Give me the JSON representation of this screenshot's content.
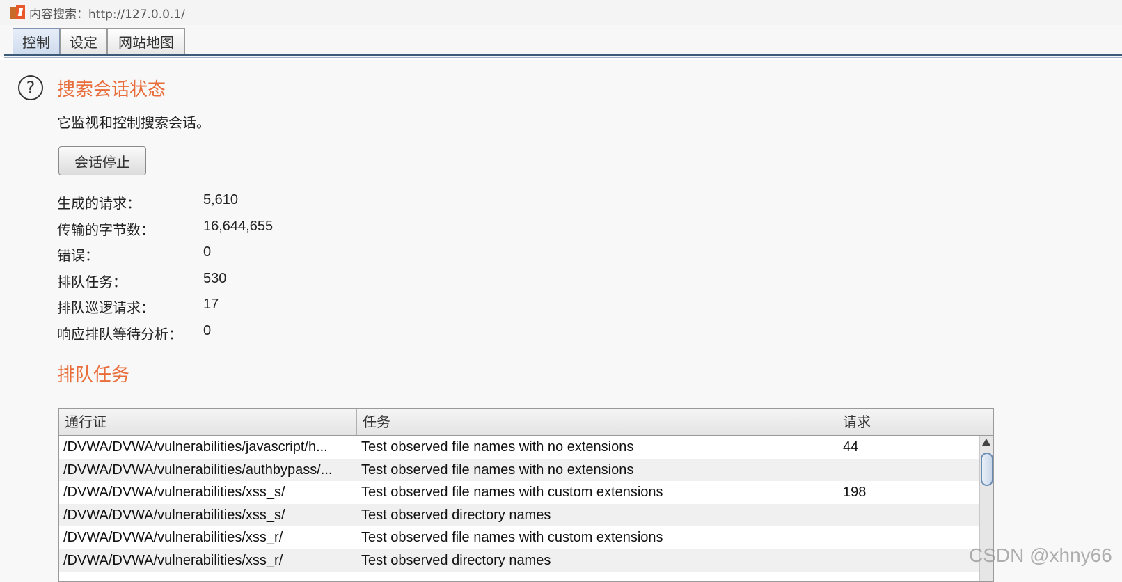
{
  "window": {
    "title": "内容搜索：http://127.0.0.1/"
  },
  "tabs": [
    {
      "label": "控制",
      "active": true
    },
    {
      "label": "设定",
      "active": false
    },
    {
      "label": "网站地图",
      "active": false
    }
  ],
  "session": {
    "title": "搜索会话状态",
    "description": "它监视和控制搜索会话。",
    "stop_button": "会话停止",
    "stats": [
      {
        "label": "生成的请求：",
        "value": "5,610"
      },
      {
        "label": "传输的字节数：",
        "value": "16,644,655"
      },
      {
        "label": "错误：",
        "value": "0"
      },
      {
        "label": "排队任务：",
        "value": "530"
      },
      {
        "label": "排队巡逻请求：",
        "value": "17"
      },
      {
        "label": "响应排队等待分析：",
        "value": "0"
      }
    ]
  },
  "queue": {
    "title": "排队任务",
    "columns": [
      "通行证",
      "任务",
      "请求"
    ],
    "rows": [
      [
        "/DVWA/DVWA/vulnerabilities/javascript/h...",
        "Test observed file names with no extensions",
        "44"
      ],
      [
        "/DVWA/DVWA/vulnerabilities/authbypass/...",
        "Test observed file names with no extensions",
        ""
      ],
      [
        "/DVWA/DVWA/vulnerabilities/xss_s/",
        "Test observed file names with custom extensions",
        "198"
      ],
      [
        "/DVWA/DVWA/vulnerabilities/xss_s/",
        "Test observed directory names",
        ""
      ],
      [
        "/DVWA/DVWA/vulnerabilities/xss_r/",
        "Test observed file names with custom extensions",
        ""
      ],
      [
        "/DVWA/DVWA/vulnerabilities/xss_r/",
        "Test observed directory names",
        ""
      ]
    ]
  },
  "watermark": "CSDN @xhny66",
  "colors": {
    "accent": "#e86d3a",
    "tab_rule": "#3c5a7a"
  }
}
